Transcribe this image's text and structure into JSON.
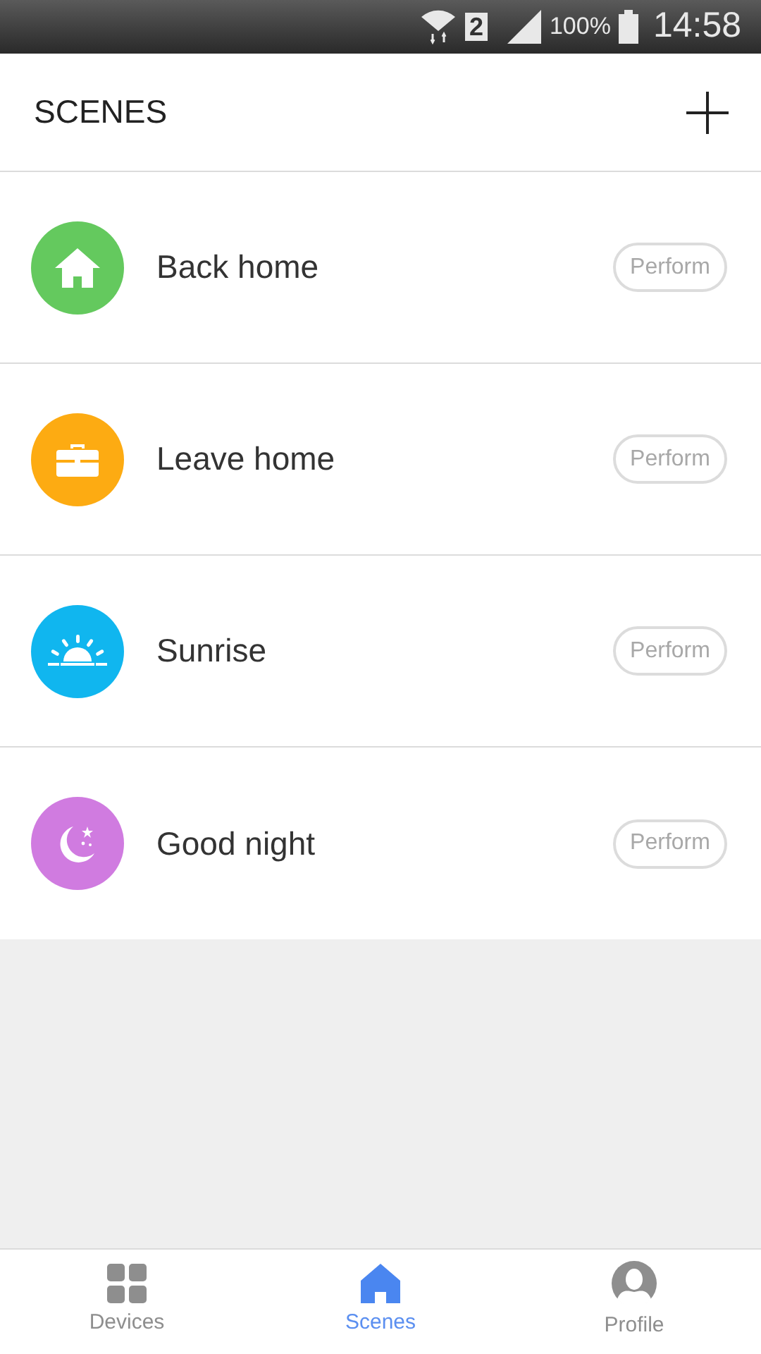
{
  "status_bar": {
    "sim": "2",
    "battery": "100%",
    "time": "14:58"
  },
  "header": {
    "title": "SCENES"
  },
  "scenes": [
    {
      "name": "Back home",
      "kind": "house",
      "color": "#64c95e",
      "action": "Perform"
    },
    {
      "name": "Leave home",
      "kind": "briefcase",
      "color": "#fdab12",
      "action": "Perform"
    },
    {
      "name": "Sunrise",
      "kind": "sunrise",
      "color": "#10b6ef",
      "action": "Perform"
    },
    {
      "name": "Good night",
      "kind": "moon",
      "color": "#d07be0",
      "action": "Perform"
    }
  ],
  "tabs": [
    {
      "label": "Devices",
      "kind": "grid",
      "selected": false
    },
    {
      "label": "Scenes",
      "kind": "house",
      "selected": true
    },
    {
      "label": "Profile",
      "kind": "person",
      "selected": false
    }
  ]
}
